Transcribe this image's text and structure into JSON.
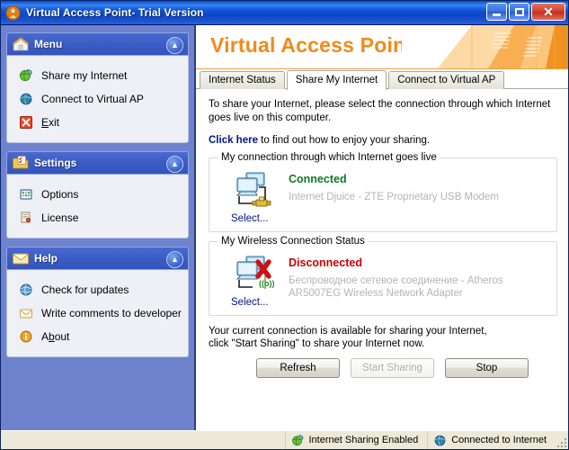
{
  "window": {
    "title": "Virtual Access Point- Trial Version",
    "app_icon": "app-orb-icon",
    "controls": {
      "minimize": "minimize-icon",
      "maximize": "maximize-icon",
      "close": "✕"
    }
  },
  "sidebar": {
    "panels": [
      {
        "title": "Menu",
        "icon": "house-icon",
        "collapse": "chevron-up-icon",
        "items": [
          {
            "label": "Share my Internet",
            "icon": "globe-green-icon"
          },
          {
            "label": "Connect to Virtual AP",
            "icon": "globe-blue-icon"
          },
          {
            "label_pre": "",
            "label_underline": "E",
            "label_post": "xit",
            "label": "Exit",
            "icon": "exit-red-x-icon"
          }
        ]
      },
      {
        "title": "Settings",
        "icon": "folder-checklist-icon",
        "collapse": "chevron-up-icon",
        "items": [
          {
            "label": "Options",
            "icon": "options-grid-icon"
          },
          {
            "label": "License",
            "icon": "license-scroll-icon"
          }
        ]
      },
      {
        "title": "Help",
        "icon": "envelope-icon",
        "collapse": "chevron-up-icon",
        "items": [
          {
            "label": "Check for updates",
            "icon": "globe-update-icon"
          },
          {
            "label": "Write comments to developer",
            "icon": "envelope-small-icon"
          },
          {
            "label_pre": "A",
            "label_underline": "b",
            "label_post": "out",
            "label": "About",
            "icon": "about-info-icon"
          }
        ]
      }
    ]
  },
  "banner": {
    "title": "Virtual Access Point",
    "accent_color": "#f08a1c"
  },
  "tabs": [
    {
      "label": "Internet Status",
      "active": false
    },
    {
      "label": "Share My Internet",
      "active": true
    },
    {
      "label": "Connect to Virtual AP",
      "active": false
    }
  ],
  "main": {
    "intro": "To share your Internet, please select the connection through which Internet goes live on this computer.",
    "click_here": "Click here",
    "click_tail": " to find out how to enjoy your sharing.",
    "groups": [
      {
        "legend": "My connection  through which Internet goes live",
        "icon": "two-monitors-connected-icon",
        "status": "Connected",
        "status_color": "#0b7a27",
        "adapter": "Internet Djuice - ZTE Proprietary USB Modem",
        "select_label": "Select..."
      },
      {
        "legend": "My Wireless Connection Status",
        "icon": "two-monitors-wireless-error-icon",
        "status": "Disconnected",
        "status_color": "#cc0000",
        "adapter": "Беспроводное сетевое соединение - Atheros AR5007EG Wireless Network Adapter",
        "select_label": "Select..."
      }
    ],
    "footer_message_line1": "Your current connection is available for sharing your Internet,",
    "footer_message_line2": "click \"Start Sharing\" to share your Internet now.",
    "buttons": [
      {
        "label": "Refresh",
        "disabled": false
      },
      {
        "label": "Start Sharing",
        "disabled": true
      },
      {
        "label": "Stop",
        "disabled": false
      }
    ]
  },
  "statusbar": {
    "cells": [
      {
        "label": "Internet Sharing Enabled",
        "icon": "globe-green-icon"
      },
      {
        "label": "Connected to Internet",
        "icon": "globe-blue-icon"
      }
    ]
  }
}
